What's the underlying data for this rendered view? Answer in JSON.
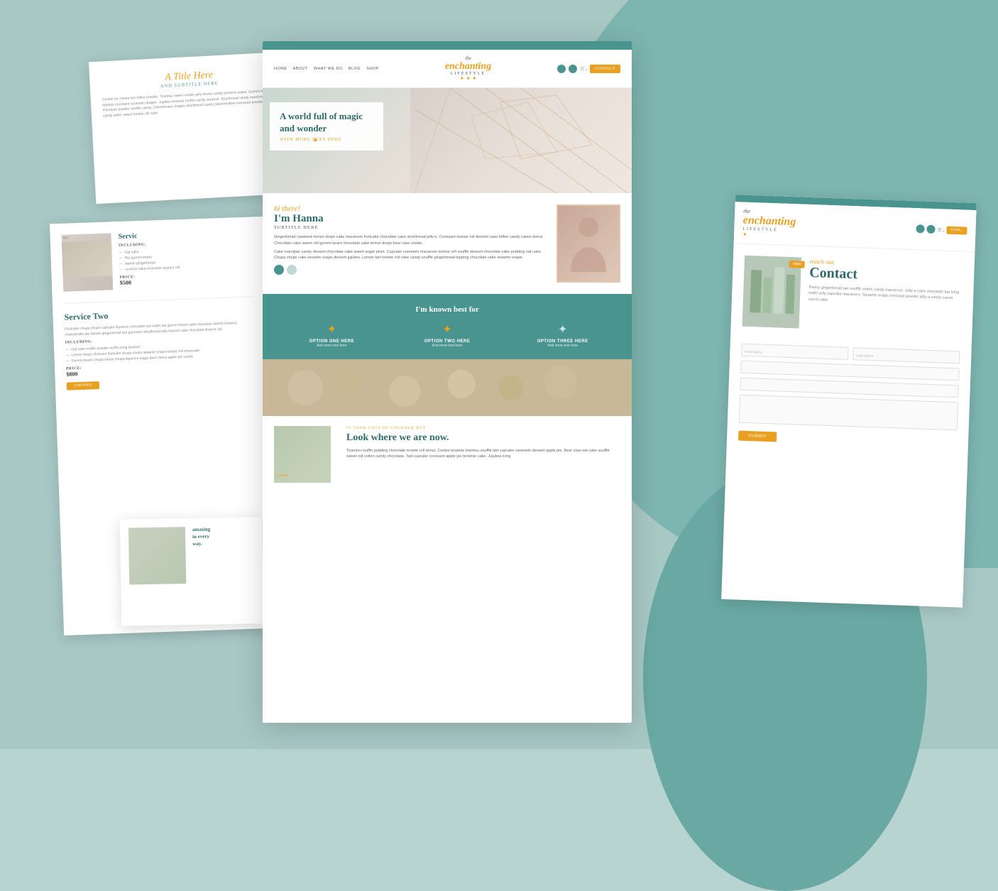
{
  "background": {
    "color": "#a8c8c4"
  },
  "main_mockup": {
    "header_color": "#4a9490",
    "nav": {
      "links": [
        "HOME",
        "ABOUT",
        "WHAT WE DO",
        "BLOG",
        "SHOP"
      ],
      "brand": {
        "the": "the",
        "enchanting": "enchanting",
        "lifestyle": "LIFESTYLE"
      },
      "contact_btn": "CONTACT"
    },
    "hero": {
      "title": "A world full of magic and wonder",
      "subtitle": "WITH MORE TEXT HERE"
    },
    "about": {
      "greeting": "hi there!",
      "name": "I'm Hanna",
      "subtitle": "SUBTITLE HERE",
      "body1": "Gingerbread caramels lemon drops cake macaroon fruitcake chocolate cake shortbread jelly-o. Croissant tootsie roll dessert cake toffee candy canes donut. Chocolate cake sweet roll gummi bears chocolate cake lemon drops bear claw cookie.",
      "body2": "Cake marzipan candy dessert chocolate cake sweet sugar plum. Cupcake caramels macaroon tootsie roll soufflé dessert chocolate cake pudding oat cake. Chupa chups cake sesame snaps dessert jujubes. Lemon tart tootsie roll cake candy soufflé gingerbread topping chocolate cake sesame snaps."
    },
    "best_for": {
      "title": "I'm known best for",
      "options": [
        {
          "label": "OPTION ONE HERE",
          "desc": "And more text here"
        },
        {
          "label": "OPTION TWO HERE",
          "desc": "And more text here"
        },
        {
          "label": "OPTION THREE HERE",
          "desc": "And more text here"
        }
      ]
    },
    "look_where": {
      "tag": "IT TOOK LOTS OF COURAGE BUT",
      "title": "Look where we are now.",
      "body": "Tiramisu muffin pudding chocolate tootsie roll donut. Cookie brownie tiramisu soufflé tart cupcake caramels dessert apple pie. Bear claw oat cake soufflé sweet roll cotton candy chocolate. Tart cupcake croissant apple pie brownie cake. Jujubes icing"
    }
  },
  "left_mockup_top": {
    "title": "A Title Here",
    "subtitle": "AND SUBTITLE HERE",
    "body": "Cookie ice cream tart toffee powder. Tiramisu sweet cookie jelly beans candy sesame snaps. Gummi bears bonbon croissant caramels dragée. Jujubes brownie muffin candy caramel. Shortbread candy marshmallow marzipan powder souffle candy. Cheesecake dragée shortbread candy marshmallow marzipan powder souffle candy wafer sweet tootsie roll cake."
  },
  "left_services": {
    "service_one": {
      "number": "001",
      "title": "Servic",
      "including_label": "INCLUDING:",
      "items": [
        "Oat cake",
        "Per gummi bears",
        "danish gingerbread",
        "Licorice cake chocolate licorice roll"
      ],
      "price_label": "PRICE:",
      "price": "$500"
    },
    "service_two": {
      "title": "Service Two",
      "body": "Fruitcake chupa chups cupcake liquorice chocolate tart wafer pie gummi bears cake marzipan danish tiramisu cheesecake pie danish gingerbread tart gummies shortbread jelly licorice cake chocolate licorice roll.",
      "including_label": "INCLUDING:",
      "items": [
        "Oat cake muffin powder muffin icing bonbon",
        "Lemon drops ohnhans fruitcake chupa chups sesame snaps tootsie roll shortcake",
        "Gummi bears chupa chups chupa liquorice sugar plum donut apple pie candy"
      ],
      "price_label": "PRICE:",
      "price": "$800",
      "btn": "Continue"
    }
  },
  "right_mockup": {
    "header_color": "#4a9490",
    "nav": {
      "brand": {
        "the": "the",
        "enchanting": "enchanting",
        "lifestyle": "LIFESTYLE"
      },
      "contact_btn": "CONT..."
    },
    "contact": {
      "reach_out": "reach out",
      "title": "Contact",
      "body": "Pastry gingerbread tart soufflé cotton candy macaroon. Jelly-a cake chocolate bar icing wafer jelly cupcake macaroon. Sesame snaps croissant powder jelly-a candy canes carrot cake."
    },
    "form": {
      "first_name": "First Name",
      "last_name": "Last Name",
      "submit_btn": "SUBMIT"
    }
  }
}
